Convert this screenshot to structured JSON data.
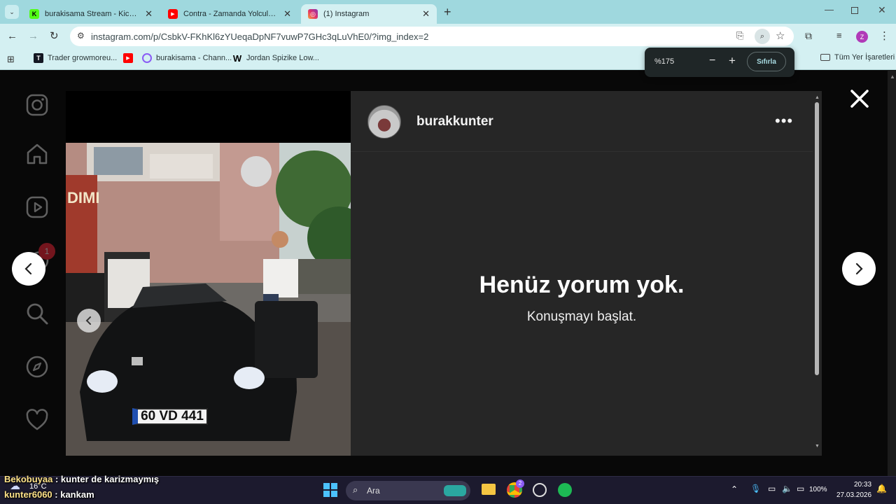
{
  "browser": {
    "tabs": [
      {
        "label": "burakisama Stream - Kick Dashb",
        "favicon": "kick-icon",
        "fav_color": "#53fc18",
        "fav_text": "K",
        "active": false
      },
      {
        "label": "Contra - Zamanda Yolculuk - Yo",
        "favicon": "youtube-icon",
        "fav_color": "#ff0000",
        "fav_text": "▶",
        "active": false
      },
      {
        "label": "(1) Instagram",
        "favicon": "instagram-icon",
        "fav_color": "#e1306c",
        "fav_text": "◎",
        "active": true
      }
    ],
    "url": "instagram.com/p/CsbkV-FKhKl6zYUeqaDpNF7vuwP7GHc3qLuVhE0/?img_index=2",
    "bookmarks": [
      {
        "label": "Trader growmoreu...",
        "icon": "tradingview-icon"
      },
      {
        "label": "",
        "icon": "youtube-icon"
      },
      {
        "label": "burakisama - Chann...",
        "icon": "channel-icon"
      },
      {
        "label": "Jordan Spizike Low...",
        "icon": "w-icon",
        "icon_text": "W"
      }
    ],
    "all_bookmarks_label": "Tüm Yer İşaretleri",
    "profile_initial": "Z"
  },
  "zoom": {
    "level": "%175",
    "minus": "−",
    "plus": "+",
    "reset_label": "Sıfırla"
  },
  "instagram": {
    "notification_count": "1",
    "post": {
      "username": "burakkunter",
      "more": "•••",
      "plate": "60 VD 441",
      "empty_title": "Henüz yorum yok.",
      "empty_subtitle": "Konuşmayı başlat."
    }
  },
  "chat": [
    {
      "user": "Bekobuyaa",
      "message": " : kunter de karizmaymış"
    },
    {
      "user": "kunter6060",
      "message": " : kankam"
    }
  ],
  "taskbar": {
    "search_placeholder": "Ara",
    "weather": "16°C",
    "battery": "100%",
    "time": "20:33",
    "date": "27.03.2026",
    "chrome_badge": "2"
  }
}
